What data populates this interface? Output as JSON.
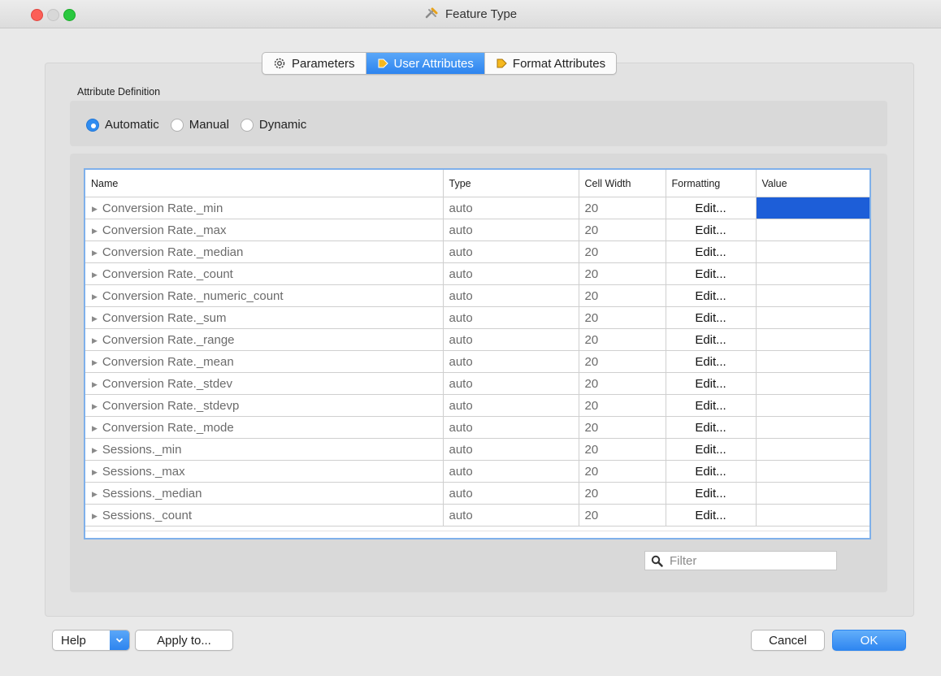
{
  "window": {
    "title": "Feature Type"
  },
  "tabs": [
    {
      "label": "Parameters",
      "icon": "gear-icon"
    },
    {
      "label": "User Attributes",
      "icon": "diamond-arrow-icon"
    },
    {
      "label": "Format Attributes",
      "icon": "diamond-arrow-icon"
    }
  ],
  "active_tab": "User Attributes",
  "attribute_definition": {
    "label": "Attribute Definition",
    "options": [
      "Automatic",
      "Manual",
      "Dynamic"
    ],
    "selected": "Automatic"
  },
  "table": {
    "columns": [
      "Name",
      "Type",
      "Cell Width",
      "Formatting",
      "Value"
    ],
    "rows": [
      {
        "name": "Conversion Rate._min",
        "type": "auto",
        "width": "20",
        "formatting": "Edit...",
        "value": ""
      },
      {
        "name": "Conversion Rate._max",
        "type": "auto",
        "width": "20",
        "formatting": "Edit...",
        "value": ""
      },
      {
        "name": "Conversion Rate._median",
        "type": "auto",
        "width": "20",
        "formatting": "Edit...",
        "value": ""
      },
      {
        "name": "Conversion Rate._count",
        "type": "auto",
        "width": "20",
        "formatting": "Edit...",
        "value": ""
      },
      {
        "name": "Conversion Rate._numeric_count",
        "type": "auto",
        "width": "20",
        "formatting": "Edit...",
        "value": ""
      },
      {
        "name": "Conversion Rate._sum",
        "type": "auto",
        "width": "20",
        "formatting": "Edit...",
        "value": ""
      },
      {
        "name": "Conversion Rate._range",
        "type": "auto",
        "width": "20",
        "formatting": "Edit...",
        "value": ""
      },
      {
        "name": "Conversion Rate._mean",
        "type": "auto",
        "width": "20",
        "formatting": "Edit...",
        "value": ""
      },
      {
        "name": "Conversion Rate._stdev",
        "type": "auto",
        "width": "20",
        "formatting": "Edit...",
        "value": ""
      },
      {
        "name": "Conversion Rate._stdevp",
        "type": "auto",
        "width": "20",
        "formatting": "Edit...",
        "value": ""
      },
      {
        "name": "Conversion Rate._mode",
        "type": "auto",
        "width": "20",
        "formatting": "Edit...",
        "value": ""
      },
      {
        "name": "Sessions._min",
        "type": "auto",
        "width": "20",
        "formatting": "Edit...",
        "value": ""
      },
      {
        "name": "Sessions._max",
        "type": "auto",
        "width": "20",
        "formatting": "Edit...",
        "value": ""
      },
      {
        "name": "Sessions._median",
        "type": "auto",
        "width": "20",
        "formatting": "Edit...",
        "value": ""
      },
      {
        "name": "Sessions._count",
        "type": "auto",
        "width": "20",
        "formatting": "Edit...",
        "value": ""
      }
    ]
  },
  "filter": {
    "placeholder": "Filter",
    "value": ""
  },
  "buttons": {
    "help": "Help",
    "apply": "Apply to...",
    "cancel": "Cancel",
    "ok": "OK"
  },
  "colors": {
    "accent": "#2f8cf0",
    "selected_cell": "#1d5ed8",
    "close": "#fc5f57",
    "maximize": "#2ac83f"
  }
}
